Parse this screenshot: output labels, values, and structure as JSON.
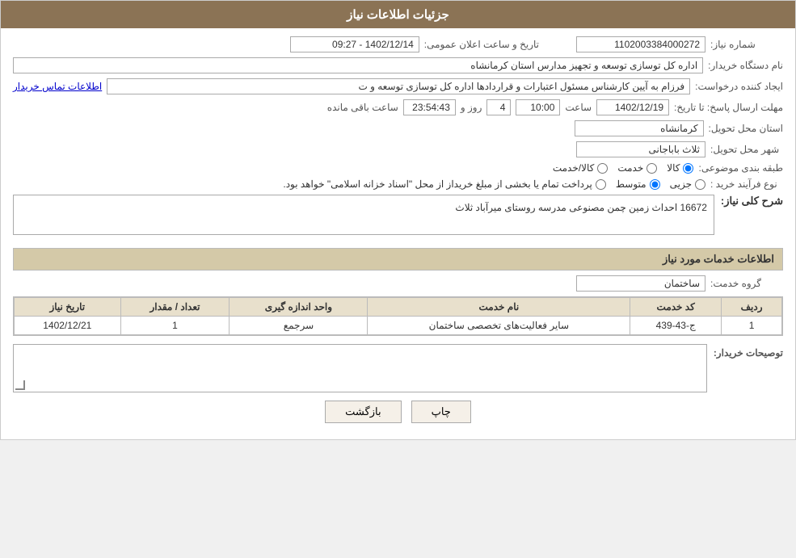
{
  "header": {
    "title": "جزئیات اطلاعات نیاز"
  },
  "fields": {
    "shomareNiaz_label": "شماره نیاز:",
    "shomareNiaz_value": "1102003384000272",
    "tarikhLabel": "تاریخ و ساعت اعلان عمومی:",
    "tarikh_value": "1402/12/14 - 09:27",
    "namDastgah_label": "نام دستگاه خریدار:",
    "namDastgah_value": "اداره کل توسازی  توسعه و تجهیز مدارس استان کرمانشاه",
    "ijadKonande_label": "ایجاد کننده درخواست:",
    "ijadKonande_value": "فرزام به آیین کارشناس مسئول اعتبارات و قراردادها اداره کل توسازی  توسعه و ت",
    "tamaseLink": "اطلاعات تماس خریدار",
    "mohlatErsal_label": "مهلت ارسال پاسخ: تا تاریخ:",
    "mohlatDate": "1402/12/19",
    "mohlatSaat_label": "ساعت",
    "mohlatSaat": "10:00",
    "roz_label": "روز و",
    "roz_value": "4",
    "baghimande_label": "ساعت باقی مانده",
    "baghimande_value": "23:54:43",
    "ostan_label": "استان محل تحویل:",
    "ostan_value": "کرمانشاه",
    "shahr_label": "شهر محل تحویل:",
    "shahr_value": "ثلاث باباجانی",
    "tabaghe_label": "طبقه بندی موضوعی:",
    "tabaghe_options": [
      {
        "label": "کالا",
        "value": "kala",
        "checked": true
      },
      {
        "label": "خدمت",
        "value": "khedmat",
        "checked": false
      },
      {
        "label": "کالا/خدمت",
        "value": "kalaKhedmat",
        "checked": false
      }
    ],
    "noeFarayand_label": "نوع فرآیند خرید :",
    "noeFarayand_options": [
      {
        "label": "جزیی",
        "value": "jozei",
        "checked": false
      },
      {
        "label": "متوسط",
        "value": "motevaset",
        "checked": true
      },
      {
        "label": "پرداخت تمام یا بخشی از مبلغ خریدار از محل \"اسناد خزانه اسلامی\" خواهد بود.",
        "value": "esnad",
        "checked": false
      }
    ]
  },
  "sharhKoli": {
    "section_label": "شرح کلی نیاز:",
    "value": "16672 احداث زمین چمن مصنوعی مدرسه روستای میرآباد ثلاث"
  },
  "khadamatSection": {
    "title": "اطلاعات خدمات مورد نیاز",
    "groheKhedmat_label": "گروه خدمت:",
    "groheKhedmat_value": "ساختمان"
  },
  "table": {
    "headers": [
      "ردیف",
      "کد خدمت",
      "نام خدمت",
      "واحد اندازه گیری",
      "تعداد / مقدار",
      "تاریخ نیاز"
    ],
    "rows": [
      {
        "radif": "1",
        "kodKhedmat": "ج-43-439",
        "namKhedmat": "سایر فعالیت‌های تخصصی ساختمان",
        "vahed": "سرجمع",
        "tedad": "1",
        "tarikh": "1402/12/21"
      }
    ]
  },
  "toseifat": {
    "label": "توصیحات خریدار:",
    "value": ""
  },
  "buttons": {
    "chap": "چاپ",
    "bazgasht": "بازگشت"
  }
}
